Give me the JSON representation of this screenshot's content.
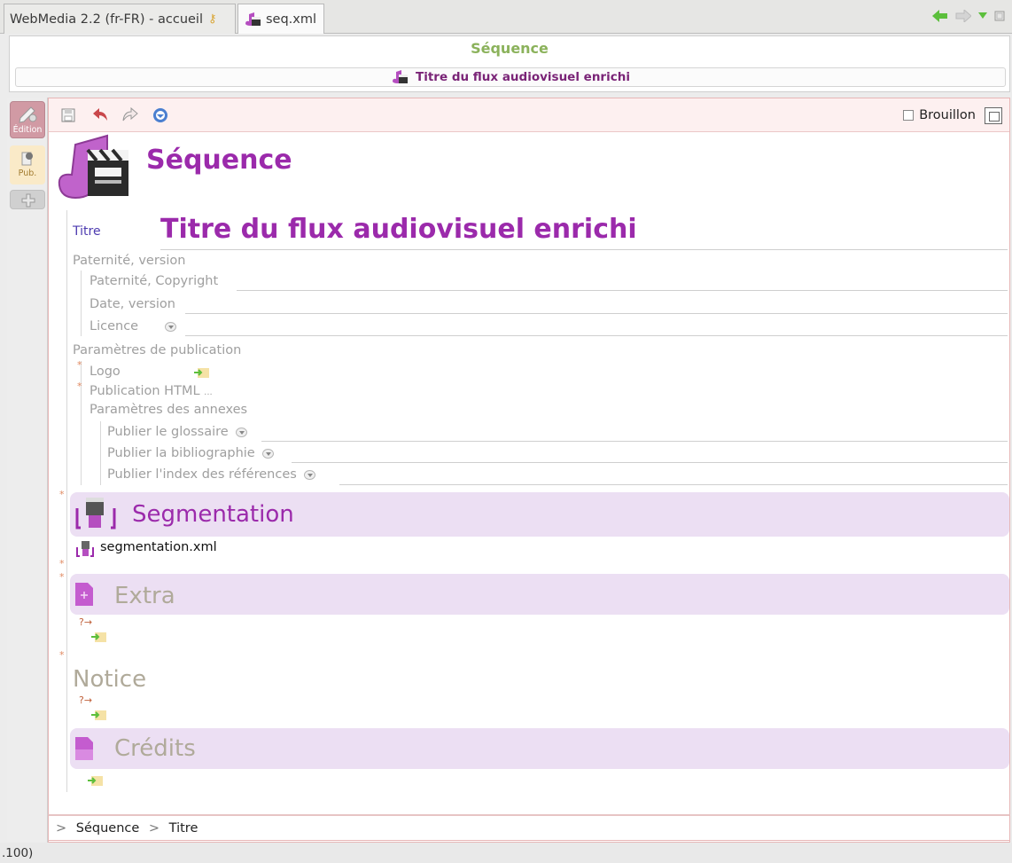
{
  "tabs": [
    {
      "label": "WebMedia 2.2 (fr-FR) - accueil"
    },
    {
      "label": "seq.xml"
    }
  ],
  "header": {
    "title": "Séquence",
    "subtitle": "Titre du flux audiovisuel enrichi"
  },
  "sidebar": {
    "edition": "Édition",
    "pub": "Pub."
  },
  "toolbar": {
    "brouillon": "Brouillon"
  },
  "doc": {
    "type_title": "Séquence",
    "titre_label": "Titre",
    "titre_value": "Titre du flux audiovisuel enrichi",
    "paternite": "Paternité, version",
    "paternite_copyright": "Paternité, Copyright",
    "date_version": "Date, version",
    "licence": "Licence",
    "params_pub": "Paramètres de publication",
    "logo": "Logo",
    "pub_html": "Publication HTML",
    "pub_html_more": "...",
    "params_annexes": "Paramètres des annexes",
    "glossaire": "Publier le glossaire",
    "biblio": "Publier la bibliographie",
    "index_refs": "Publier l'index des références",
    "segmentation": "Segmentation",
    "segmentation_file": "segmentation.xml",
    "extra": "Extra",
    "notice": "Notice",
    "credits": "Crédits",
    "required": "*",
    "missing_link": "?→"
  },
  "breadcrumb": [
    "Séquence",
    "Titre"
  ],
  "breadcrumb_sep": ">",
  "status": ".100)",
  "colors": {
    "accent_purple": "#9b2aab",
    "header_green": "#8bb25b",
    "band": "#ecdff3"
  }
}
